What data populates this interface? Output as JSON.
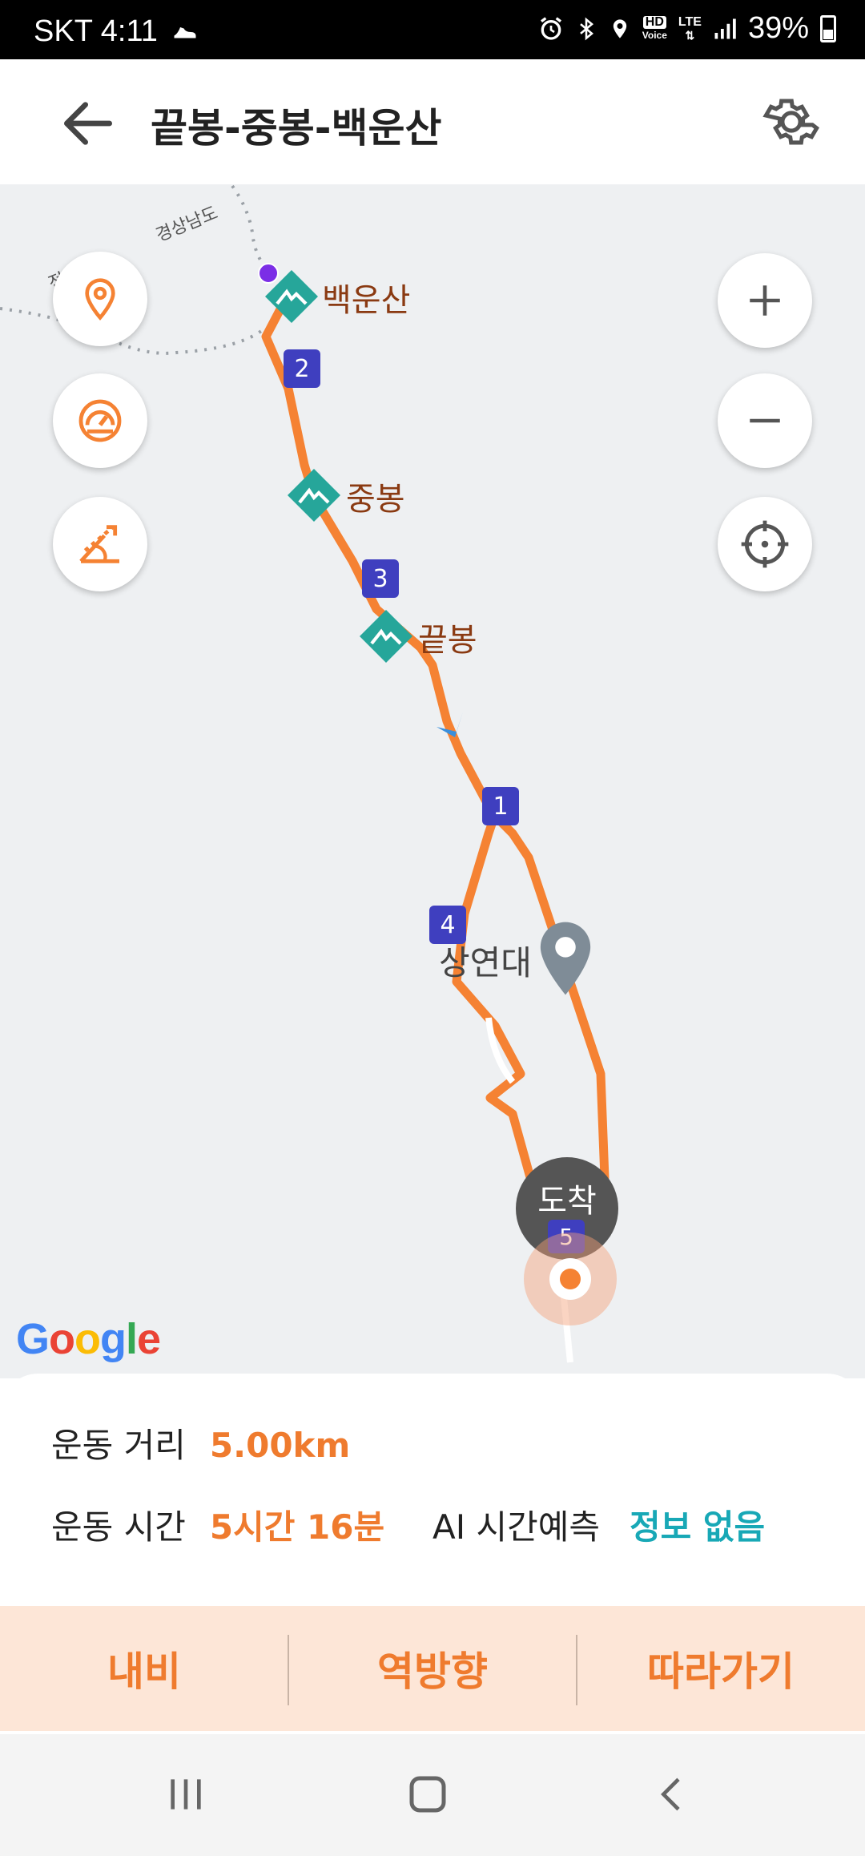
{
  "status_bar": {
    "carrier_time": "SKT 4:11",
    "battery": "39%",
    "icons": [
      "shoe-icon",
      "alarm-icon",
      "bluetooth-icon",
      "location-icon",
      "hd-voice-icon",
      "lte-icon",
      "signal-icon",
      "battery-icon"
    ],
    "hd_label": "HD",
    "voice_label": "Voice",
    "lte_label": "LTE"
  },
  "header": {
    "title": "끝봉-중봉-백운산"
  },
  "map": {
    "region_labels": [
      "경상남도",
      "전라남도"
    ],
    "peaks": [
      {
        "name": "백운산"
      },
      {
        "name": "중봉"
      },
      {
        "name": "끝봉"
      }
    ],
    "markers": [
      "1",
      "2",
      "3",
      "4",
      "5"
    ],
    "place": "상연대",
    "arrival": "도착",
    "google": "Google"
  },
  "info": {
    "distance_label": "운동 거리",
    "distance_value": "5.00km",
    "time_label": "운동 시간",
    "time_value": "5시간 16분",
    "ai_label": "AI 시간예측",
    "ai_value": "정보 없음"
  },
  "actions": {
    "navi": "내비",
    "reverse": "역방향",
    "follow": "따라가기"
  },
  "colors": {
    "accent": "#ef7b2e",
    "teal": "#18a8b6",
    "peak": "#26a69a",
    "marker": "#3f3fbf"
  }
}
